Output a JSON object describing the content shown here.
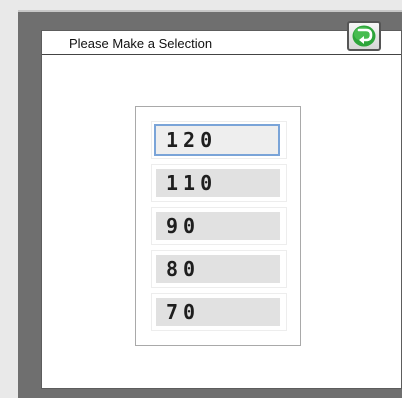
{
  "dialog": {
    "title": "Please Make a Selection",
    "back_icon": "green-return-arrow-icon"
  },
  "options": [
    {
      "label": "120",
      "selected": true
    },
    {
      "label": "110",
      "selected": false
    },
    {
      "label": "90",
      "selected": false
    },
    {
      "label": "80",
      "selected": false
    },
    {
      "label": "70",
      "selected": false
    }
  ],
  "colors": {
    "selection_border": "#7aa4d8",
    "option_fill": "#e1e1e1",
    "frame": "#6f6f6f"
  }
}
